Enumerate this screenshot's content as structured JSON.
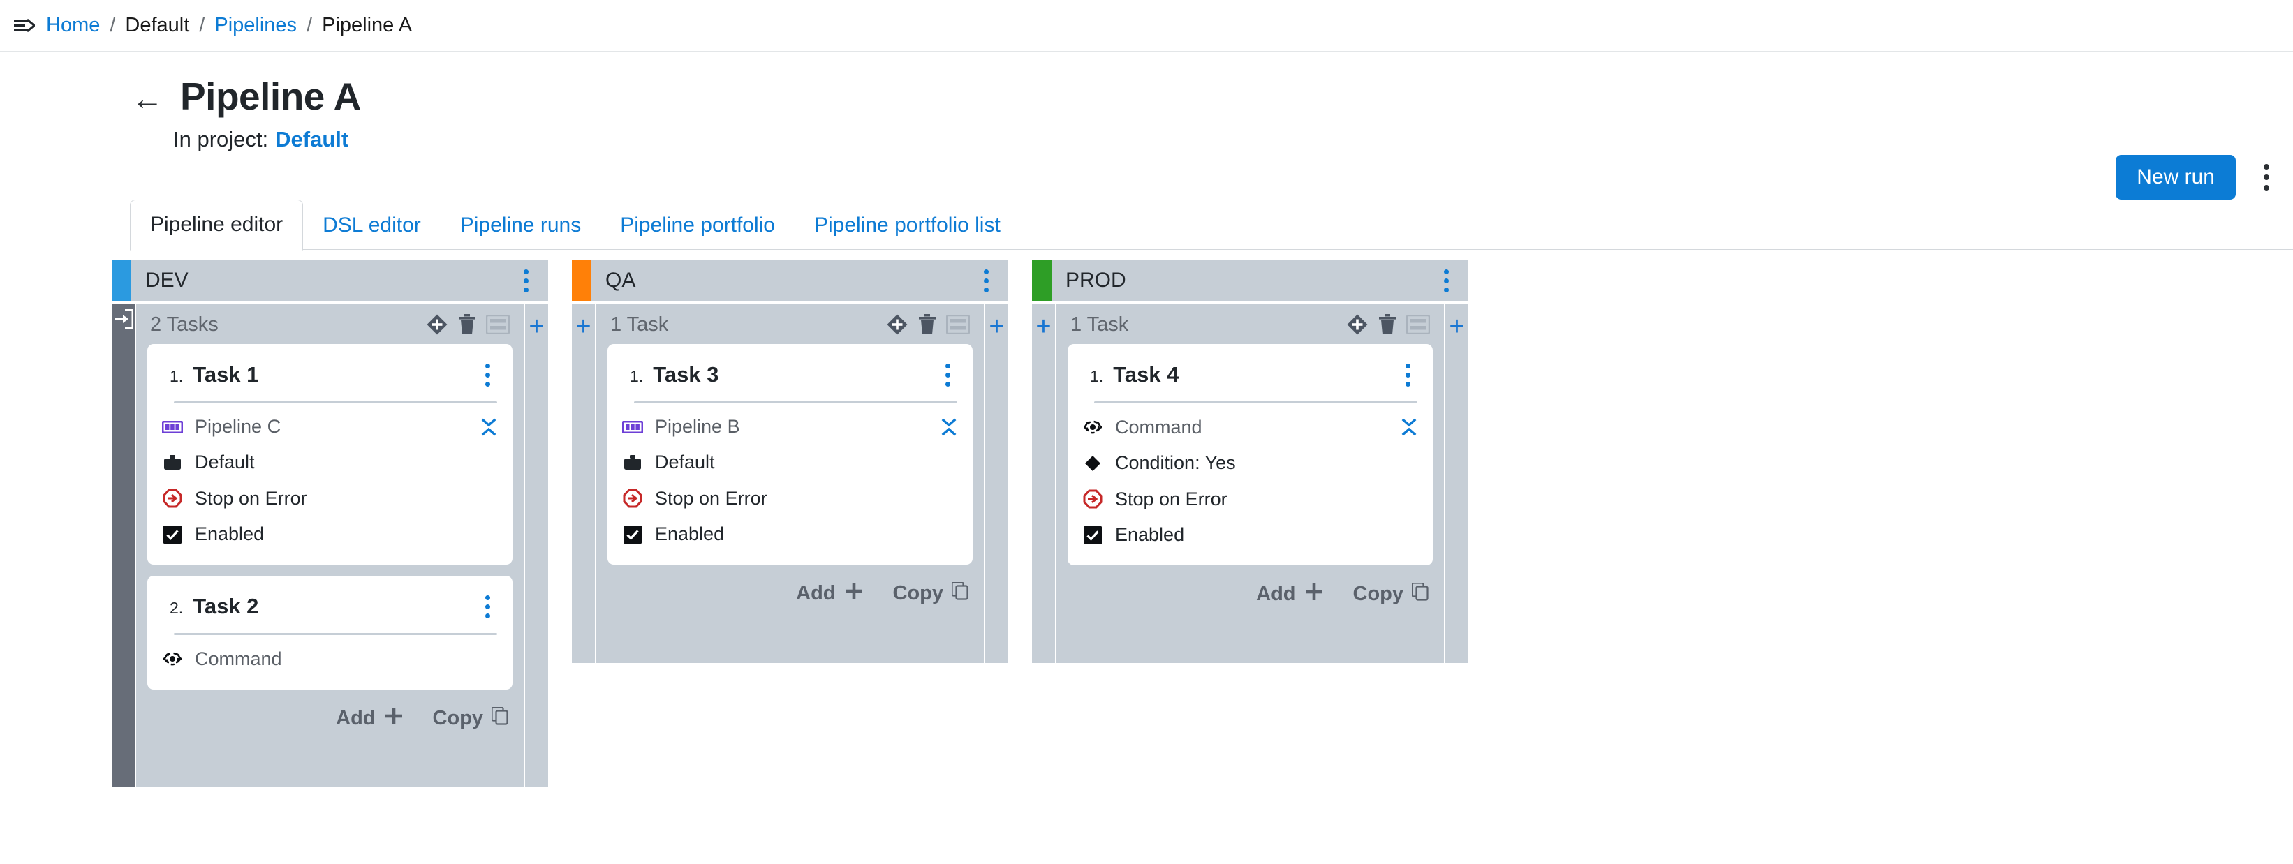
{
  "breadcrumb": {
    "menu_icon": "hamburger-arrow-icon",
    "items": [
      {
        "label": "Home",
        "link": true
      },
      {
        "label": "Default",
        "link": false
      },
      {
        "label": "Pipelines",
        "link": true
      },
      {
        "label": "Pipeline A",
        "link": false
      }
    ],
    "separator": "/"
  },
  "header": {
    "back_arrow": "←",
    "title": "Pipeline A",
    "project_prefix": "In project:",
    "project_name": "Default",
    "new_run_label": "New run",
    "overflow_menu": "kebab-menu-icon"
  },
  "tabs": [
    {
      "label": "Pipeline editor",
      "active": true
    },
    {
      "label": "DSL editor",
      "active": false
    },
    {
      "label": "Pipeline runs",
      "active": false
    },
    {
      "label": "Pipeline portfolio",
      "active": false
    },
    {
      "label": "Pipeline portfolio list",
      "active": false
    }
  ],
  "board": {
    "footer": {
      "add_label": "Add",
      "copy_label": "Copy"
    },
    "stage_icons": {
      "condition": "diamond-plus-icon",
      "delete": "trash-icon",
      "layout": "rows-layout-icon"
    },
    "stages": [
      {
        "name": "DEV",
        "color": "#2b9ae0",
        "task_count_label": "2 Tasks",
        "entry_point": true,
        "tall": true,
        "tasks": [
          {
            "index": "1.",
            "name": "Task 1",
            "rows": [
              {
                "icon": "pipeline-icon",
                "label": "Pipeline C",
                "muted": true,
                "collapse": true
              },
              {
                "icon": "briefcase-icon",
                "label": "Default",
                "muted": false,
                "collapse": false
              },
              {
                "icon": "stop-on-error-icon",
                "label": "Stop on Error",
                "muted": false,
                "collapse": false
              },
              {
                "icon": "checkbox-checked-icon",
                "label": "Enabled",
                "muted": false,
                "collapse": false
              }
            ]
          },
          {
            "index": "2.",
            "name": "Task 2",
            "rows": [
              {
                "icon": "command-icon",
                "label": "Command",
                "muted": true,
                "collapse": false
              }
            ]
          }
        ]
      },
      {
        "name": "QA",
        "color": "#ff8008",
        "task_count_label": "1 Task",
        "entry_point": false,
        "tall": false,
        "tasks": [
          {
            "index": "1.",
            "name": "Task 3",
            "rows": [
              {
                "icon": "pipeline-icon",
                "label": "Pipeline B",
                "muted": true,
                "collapse": true
              },
              {
                "icon": "briefcase-icon",
                "label": "Default",
                "muted": false,
                "collapse": false
              },
              {
                "icon": "stop-on-error-icon",
                "label": "Stop on Error",
                "muted": false,
                "collapse": false
              },
              {
                "icon": "checkbox-checked-icon",
                "label": "Enabled",
                "muted": false,
                "collapse": false
              }
            ]
          }
        ]
      },
      {
        "name": "PROD",
        "color": "#2e9e26",
        "task_count_label": "1 Task",
        "entry_point": false,
        "tall": false,
        "tasks": [
          {
            "index": "1.",
            "name": "Task 4",
            "rows": [
              {
                "icon": "command-icon",
                "label": "Command",
                "muted": true,
                "collapse": true
              },
              {
                "icon": "diamond-icon",
                "label": "Condition: Yes",
                "muted": false,
                "collapse": false
              },
              {
                "icon": "stop-on-error-icon",
                "label": "Stop on Error",
                "muted": false,
                "collapse": false
              },
              {
                "icon": "checkbox-checked-icon",
                "label": "Enabled",
                "muted": false,
                "collapse": false
              }
            ]
          }
        ]
      }
    ]
  },
  "colors": {
    "accent": "#0d7bd4",
    "stage_header_bg": "#c6ced6",
    "entry_strip": "#676d78",
    "error_red": "#c62828",
    "pipeline_purple": "#6d3fd6"
  }
}
